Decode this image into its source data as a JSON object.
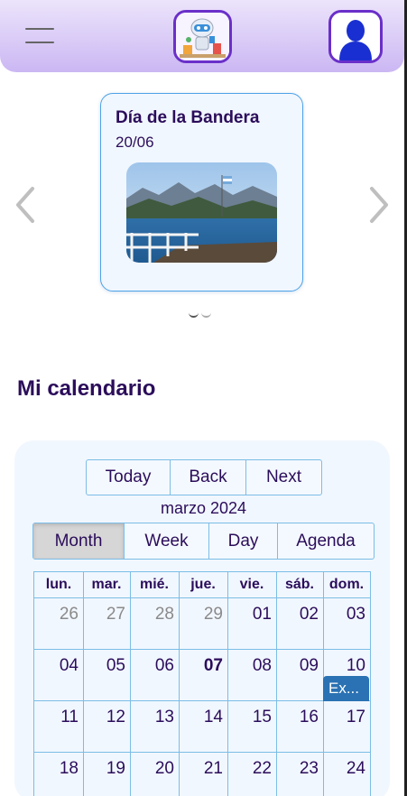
{
  "header": {
    "menu_icon": "hamburger-menu-icon",
    "logo_icon": "robot-logo-icon",
    "avatar_icon": "user-avatar-icon"
  },
  "carousel": {
    "prev_icon": "chevron-left-icon",
    "next_icon": "chevron-right-icon",
    "card": {
      "title": "Día de la Bandera",
      "date": "20/06"
    },
    "dot_count": 2
  },
  "section": {
    "title": "Mi calendario"
  },
  "calendar": {
    "nav": {
      "today": "Today",
      "back": "Back",
      "next": "Next"
    },
    "month_label": "marzo 2024",
    "views": {
      "month": "Month",
      "week": "Week",
      "day": "Day",
      "agenda": "Agenda",
      "active": "month"
    },
    "weekdays": [
      "lun.",
      "mar.",
      "mié.",
      "jue.",
      "vie.",
      "sáb.",
      "dom."
    ],
    "weeks": [
      [
        "26",
        "27",
        "28",
        "29",
        "01",
        "02",
        "03"
      ],
      [
        "04",
        "05",
        "06",
        "07",
        "08",
        "09",
        "10"
      ],
      [
        "11",
        "12",
        "13",
        "14",
        "15",
        "16",
        "17"
      ],
      [
        "18",
        "19",
        "20",
        "21",
        "22",
        "23",
        "24"
      ]
    ],
    "off_range_days": [
      "26",
      "27",
      "28",
      "29"
    ],
    "today": "07",
    "event": {
      "label": "Ex...",
      "day": "10"
    },
    "colors": {
      "accent": "#2a72b3",
      "border": "#7bbde6",
      "text": "#2b0d5a"
    }
  }
}
